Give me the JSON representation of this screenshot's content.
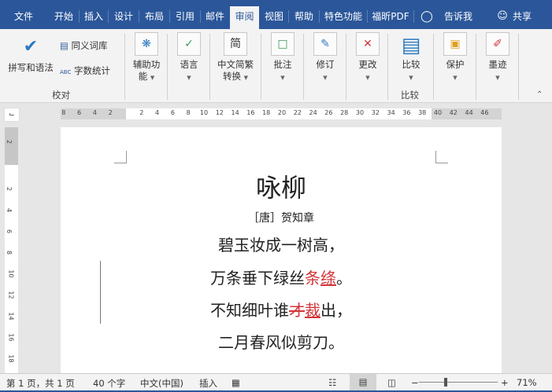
{
  "tabs": [
    "文件",
    "开始",
    "插入",
    "设计",
    "布局",
    "引用",
    "邮件",
    "审阅",
    "视图",
    "帮助",
    "特色功能",
    "福昕PDF"
  ],
  "active_tab": "审阅",
  "tell_me": "告诉我",
  "share": "共享",
  "ribbon": {
    "spelling": "拼写和语法",
    "thesaurus": "同义词库",
    "word_count": "字数统计",
    "group_proofing": "校对",
    "accessibility": [
      "辅助功",
      "能"
    ],
    "language": "语言",
    "chinese_conv": [
      "中文简繁",
      "转换"
    ],
    "comments": "批注",
    "tracking": "修订",
    "changes": "更改",
    "compare": "比较",
    "group_compare": "比较",
    "protect": "保护",
    "ink": "墨迹"
  },
  "hruler": [
    "8",
    "6",
    "4",
    "2",
    "2",
    "4",
    "6",
    "8",
    "10",
    "12",
    "14",
    "16",
    "18",
    "20",
    "22",
    "24",
    "26",
    "28",
    "30",
    "32",
    "34",
    "36",
    "38",
    "40",
    "42",
    "44",
    "46"
  ],
  "vruler": [
    "2",
    "2",
    "4",
    "6",
    "8",
    "10",
    "12",
    "14",
    "16",
    "18"
  ],
  "doc": {
    "title": "咏柳",
    "author": "［唐］贺知章",
    "l1": "碧玉妆成一树高，",
    "l2a": "万条垂下绿丝",
    "l2b": "条",
    "l2c": "绦",
    "l2d": "。",
    "l3a": "不知细叶谁",
    "l3b": "才",
    "l3c": "裁",
    "l3d": "出，",
    "l4": "二月春风似剪刀。"
  },
  "status": {
    "page": "第 1 页，共 1 页",
    "words": "40 个字",
    "lang": "中文(中国)",
    "mode": "插入",
    "zoom": "71%",
    "zoom_level": 71
  },
  "colors": {
    "brand": "#2b579a",
    "revision": "#d13438"
  }
}
